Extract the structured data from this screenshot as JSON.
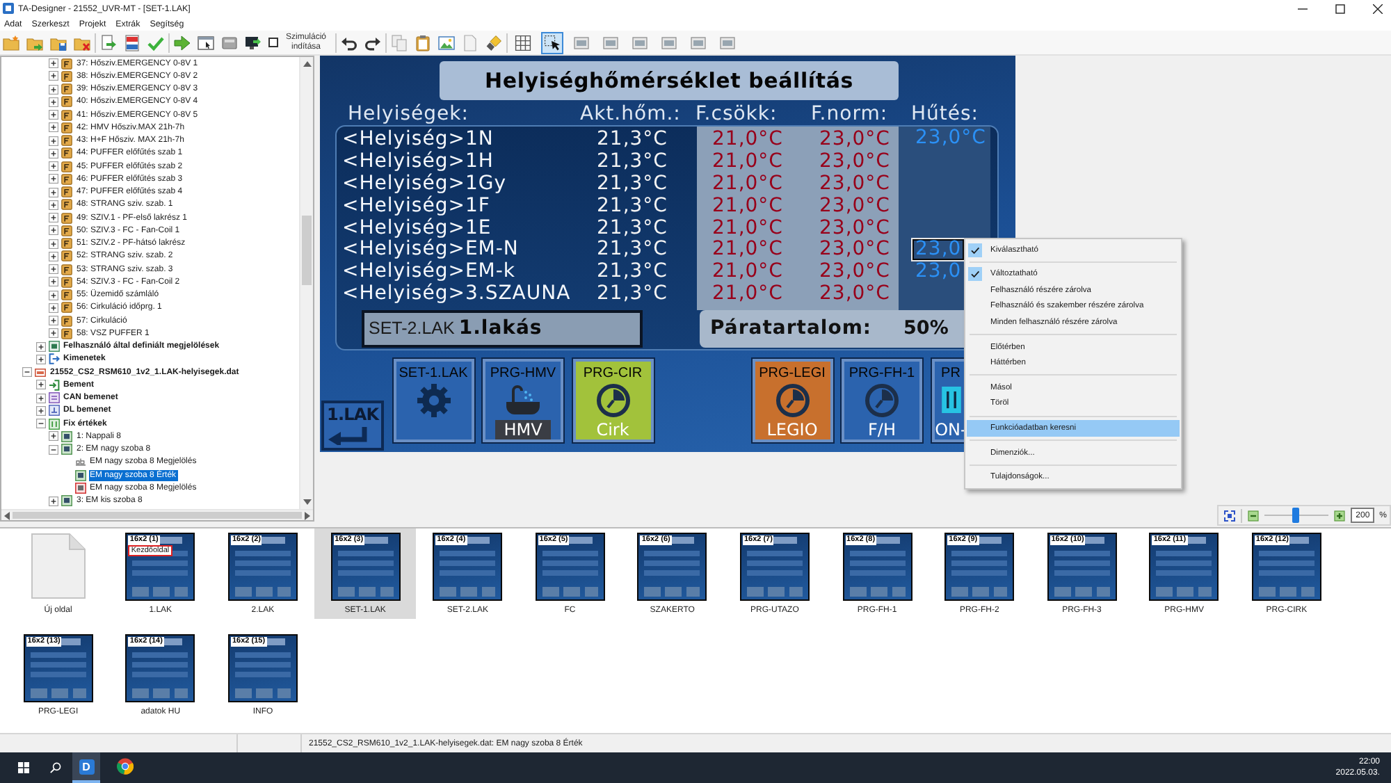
{
  "window": {
    "title": "TA-Designer - 21552_UVR-MT - [SET-1.LAK]"
  },
  "menu": [
    "Adat",
    "Szerkeszt",
    "Projekt",
    "Extrák",
    "Segítség"
  ],
  "toolbar": [
    {
      "buttons": [
        {
          "kind": "folder-star"
        },
        {
          "kind": "folder-arrow"
        },
        {
          "kind": "folder-disk"
        },
        {
          "kind": "folder-cross"
        }
      ]
    },
    {
      "buttons": [
        {
          "kind": "export"
        },
        {
          "kind": "document"
        },
        {
          "kind": "tick"
        }
      ]
    },
    {
      "buttons": [
        {
          "kind": "arrow"
        },
        {
          "kind": "window"
        },
        {
          "kind": "device"
        },
        {
          "kind": "monitor"
        },
        {
          "kind": "checkbox",
          "label": "Szimuláció indítása",
          "checked": false
        }
      ]
    },
    {
      "buttons": [
        {
          "kind": "undo"
        },
        {
          "kind": "redo"
        }
      ]
    },
    {
      "buttons": [
        {
          "kind": "copy"
        },
        {
          "kind": "paste"
        },
        {
          "kind": "image"
        },
        {
          "kind": "page"
        },
        {
          "kind": "brush"
        }
      ]
    },
    {
      "buttons": [
        {
          "kind": "grid",
          "selected": false
        },
        {
          "kind": "cursor",
          "selected": true
        },
        {
          "kind": "frame",
          "selected": false
        },
        {
          "kind": "frame",
          "selected": false
        },
        {
          "kind": "frame",
          "selected": false
        },
        {
          "kind": "frame",
          "selected": false
        },
        {
          "kind": "frame",
          "selected": false
        },
        {
          "kind": "frame",
          "selected": false
        }
      ]
    }
  ],
  "tree": [
    {
      "children": [
        {
          "children": [
            {
              "label": "37: Hősziv.EMERGENCY 0-8V 1",
              "kind": "function",
              "expanded": false,
              "selected": false
            },
            {
              "label": "38: Hősziv.EMERGENCY 0-8V 2",
              "kind": "function",
              "expanded": false,
              "selected": false
            },
            {
              "label": "39: Hősziv.EMERGENCY 0-8V 3",
              "kind": "function",
              "expanded": false,
              "selected": false
            },
            {
              "label": "40: Hősziv.EMERGENCY 0-8V 4",
              "kind": "function",
              "expanded": false,
              "selected": false
            },
            {
              "label": "41: Hősziv.EMERGENCY 0-8V 5",
              "kind": "function",
              "expanded": false,
              "selected": false
            },
            {
              "label": "42: HMV Hősziv.MAX 21h-7h",
              "kind": "function",
              "expanded": false,
              "selected": false
            },
            {
              "label": "43: H+F Hősziv. MAX 21h-7h",
              "kind": "function",
              "expanded": false,
              "selected": false
            },
            {
              "label": "44: PUFFER előfűtés szab 1",
              "kind": "function",
              "expanded": false,
              "selected": false
            },
            {
              "label": "45: PUFFER előfűtés szab 2",
              "kind": "function",
              "expanded": false,
              "selected": false
            },
            {
              "label": "46: PUFFER előfűtés szab 3",
              "kind": "function",
              "expanded": false,
              "selected": false
            },
            {
              "label": "47: PUFFER előfűtés szab 4",
              "kind": "function",
              "expanded": false,
              "selected": false
            },
            {
              "label": "48: STRANG sziv. szab. 1",
              "kind": "function",
              "expanded": false,
              "selected": false
            },
            {
              "label": "49: SZIV.1 - PF-első lakrész 1",
              "kind": "function",
              "expanded": false,
              "selected": false
            },
            {
              "label": "50: SZIV.3 - FC - Fan-Coil 1",
              "kind": "function",
              "expanded": false,
              "selected": false
            },
            {
              "label": "51: SZIV.2 - PF-hátsó lakrész",
              "kind": "function",
              "expanded": false,
              "selected": false
            },
            {
              "label": "52: STRANG sziv. szab. 2",
              "kind": "function",
              "expanded": false,
              "selected": false
            },
            {
              "label": "53: STRANG sziv. szab. 3",
              "kind": "function",
              "expanded": false,
              "selected": false
            },
            {
              "label": "54: SZIV.3 - FC - Fan-Coil 2",
              "kind": "function",
              "expanded": false,
              "selected": false
            },
            {
              "label": "55: Üzemidő számláló",
              "kind": "function",
              "expanded": false,
              "selected": false
            },
            {
              "label": "56: Cirkuláció időprg. 1",
              "kind": "function",
              "expanded": false,
              "selected": false
            },
            {
              "label": "57: Cirkuláció",
              "kind": "function",
              "expanded": false,
              "selected": false
            },
            {
              "label": "58: VSZ PUFFER 1",
              "kind": "function",
              "expanded": false,
              "selected": false
            }
          ]
        },
        {
          "label": "Felhasználó által definiált megjelölések",
          "kind": "marks",
          "expanded": false,
          "selected": false
        },
        {
          "label": "Kimenetek",
          "kind": "outputs",
          "expanded": false,
          "selected": false
        }
      ]
    },
    {
      "label": "21552_CS2_RSM610_1v2_1.LAK-helyisegek.dat",
      "kind": "file",
      "expanded": true,
      "selected": false,
      "children": [
        {
          "label": "Bement",
          "kind": "inputs",
          "expanded": false,
          "selected": false
        },
        {
          "label": "CAN bemenet",
          "kind": "can",
          "expanded": false,
          "selected": false
        },
        {
          "label": "DL bemenet",
          "kind": "dl",
          "expanded": false,
          "selected": false
        },
        {
          "label": "Fix értékek",
          "kind": "fixed",
          "expanded": true,
          "selected": false,
          "children": [
            {
              "label": "1: Nappali 8",
              "kind": "value",
              "expanded": false,
              "selected": false
            },
            {
              "label": "2: EM nagy szoba 8",
              "kind": "value",
              "expanded": true,
              "selected": false,
              "children": [
                {
                  "label": "EM nagy szoba 8 Megjelölés",
                  "kind": "text",
                  "selected": false
                },
                {
                  "label": "EM nagy szoba 8 Érték",
                  "kind": "value",
                  "selected": true
                },
                {
                  "label": "EM nagy szoba 8 Megjelölés",
                  "kind": "label",
                  "selected": false
                }
              ]
            },
            {
              "label": "3: EM kis szoba 8",
              "kind": "value",
              "expanded": false,
              "selected": false
            }
          ]
        }
      ]
    }
  ],
  "screen": {
    "title": "Helyiséghőmérséklet beállítás",
    "columns": [
      "Helyiségek:",
      "Akt.hőm.:",
      "F.csökk:",
      "F.norm:",
      "Hűtés:"
    ],
    "rows": [
      {
        "name": "<Helyiség>1N",
        "current": "21,3°C",
        "reduced": "21,0°C",
        "normal": "23,0°C",
        "cooling": {
          "value": "23,0°C",
          "selected": false
        }
      },
      {
        "name": "<Helyiség>1H",
        "current": "21,3°C",
        "reduced": "21,0°C",
        "normal": "23,0°C"
      },
      {
        "name": "<Helyiség>1Gy",
        "current": "21,3°C",
        "reduced": "21,0°C",
        "normal": "23,0°C"
      },
      {
        "name": "<Helyiség>1F",
        "current": "21,3°C",
        "reduced": "21,0°C",
        "normal": "23,0°C"
      },
      {
        "name": "<Helyiség>1E",
        "current": "21,3°C",
        "reduced": "21,0°C",
        "normal": "23,0°C"
      },
      {
        "name": "<Helyiség>EM-N",
        "current": "21,3°C",
        "reduced": "21,0°C",
        "normal": "23,0°C",
        "cooling": {
          "value": "23,0",
          "selected": true
        }
      },
      {
        "name": "<Helyiség>EM-k",
        "current": "21,3°C",
        "reduced": "21,0°C",
        "normal": "23,0°C",
        "cooling": {
          "value": "23,0",
          "selected": false
        }
      },
      {
        "name": "<Helyiség>3.SZAUNA",
        "current": "21,3°C",
        "reduced": "21,0°C",
        "normal": "23,0°C"
      }
    ],
    "name_box": {
      "label": "SET-2.LAK",
      "value": "1.lakás"
    },
    "humidity": {
      "label": "Páratartalom:",
      "value": "50%"
    },
    "back_button": {
      "label": "1.LAK"
    },
    "tiles": [
      {
        "kind": "gear",
        "caption": "SET-1.LAK",
        "color": "#2b63ae"
      },
      {
        "kind": "hmv",
        "caption": "PRG-HMV",
        "label": "HMV",
        "color": "#2b63ae"
      },
      {
        "kind": "clock",
        "caption": "PRG-CIR",
        "label": "Cirk",
        "color": "#a2c23b"
      },
      {
        "kind": "clock",
        "caption": "PRG-LEGI",
        "label": "LEGIO",
        "color": "#c8702d"
      },
      {
        "kind": "clock",
        "caption": "PRG-FH-1",
        "label": "F/H",
        "color": "#2b63ae"
      },
      {
        "kind": "switch",
        "caption": "PR",
        "label": "ON-",
        "color": "#2b63ae"
      }
    ]
  },
  "context_menu": [
    {
      "kind": "item",
      "label": "Kiválasztható",
      "checked": true,
      "selected": false
    },
    {
      "kind": "separator"
    },
    {
      "kind": "item",
      "label": "Változtatható",
      "checked": true,
      "selected": false
    },
    {
      "kind": "item",
      "label": "Felhasználó részére zárolva",
      "checked": false,
      "selected": false
    },
    {
      "kind": "item",
      "label": "Felhasználó és szakember részére zárolva",
      "checked": false,
      "selected": false
    },
    {
      "kind": "item",
      "label": "Minden felhasználó részére zárolva",
      "checked": false,
      "selected": false
    },
    {
      "kind": "separator"
    },
    {
      "kind": "item",
      "label": "Előtérben",
      "checked": false,
      "selected": false
    },
    {
      "kind": "item",
      "label": "Háttérben",
      "checked": false,
      "selected": false
    },
    {
      "kind": "separator"
    },
    {
      "kind": "item",
      "label": "Másol",
      "checked": false,
      "selected": false
    },
    {
      "kind": "item",
      "label": "Töröl",
      "checked": false,
      "selected": false
    },
    {
      "kind": "separator"
    },
    {
      "kind": "item",
      "label": "Funkcióadatban keresni",
      "checked": false,
      "selected": true
    },
    {
      "kind": "separator"
    },
    {
      "kind": "item",
      "label": "Dimenziók...",
      "checked": false,
      "selected": false
    },
    {
      "kind": "separator"
    },
    {
      "kind": "item",
      "label": "Tulajdonságok...",
      "checked": false,
      "selected": false
    }
  ],
  "zoom": {
    "level": 0.5,
    "value": "200",
    "unit": "%"
  },
  "pages": [
    {
      "kind": "new",
      "label": "Új oldal",
      "selected": false
    },
    {
      "kind": "page",
      "label": "1.LAK",
      "badge": "16x2 (1)",
      "tag": "Kezdőoldal",
      "selected": false
    },
    {
      "kind": "page",
      "label": "2.LAK",
      "badge": "16x2 (2)",
      "selected": false
    },
    {
      "kind": "page",
      "label": "SET-1.LAK",
      "badge": "16x2 (3)",
      "selected": true
    },
    {
      "kind": "page",
      "label": "SET-2.LAK",
      "badge": "16x2 (4)",
      "selected": false
    },
    {
      "kind": "page",
      "label": "FC",
      "badge": "16x2 (5)",
      "selected": false
    },
    {
      "kind": "page",
      "label": "SZAKERTO",
      "badge": "16x2 (6)",
      "selected": false
    },
    {
      "kind": "page",
      "label": "PRG-UTAZO",
      "badge": "16x2 (7)",
      "selected": false
    },
    {
      "kind": "page",
      "label": "PRG-FH-1",
      "badge": "16x2 (8)",
      "selected": false
    },
    {
      "kind": "page",
      "label": "PRG-FH-2",
      "badge": "16x2 (9)",
      "selected": false
    },
    {
      "kind": "page",
      "label": "PRG-FH-3",
      "badge": "16x2 (10)",
      "selected": false
    },
    {
      "kind": "page",
      "label": "PRG-HMV",
      "badge": "16x2 (11)",
      "selected": false
    },
    {
      "kind": "page",
      "label": "PRG-CIRK",
      "badge": "16x2 (12)",
      "selected": false
    },
    {
      "kind": "page",
      "label": "PRG-LEGI",
      "badge": "16x2 (13)",
      "selected": false
    },
    {
      "kind": "page",
      "label": "adatok HU",
      "badge": "16x2 (14)",
      "selected": false
    },
    {
      "kind": "page",
      "label": "INFO",
      "badge": "16x2 (15)",
      "selected": false
    }
  ],
  "status_bar": {
    "text": "21552_CS2_RSM610_1v2_1.LAK-helyisegek.dat: EM nagy szoba 8 Érték"
  },
  "taskbar": {
    "apps": [
      {
        "kind": "designer",
        "glyph": "D",
        "active": true
      },
      {
        "kind": "browser",
        "active": false
      }
    ],
    "time": "22:00",
    "date": "2022.05.03."
  }
}
